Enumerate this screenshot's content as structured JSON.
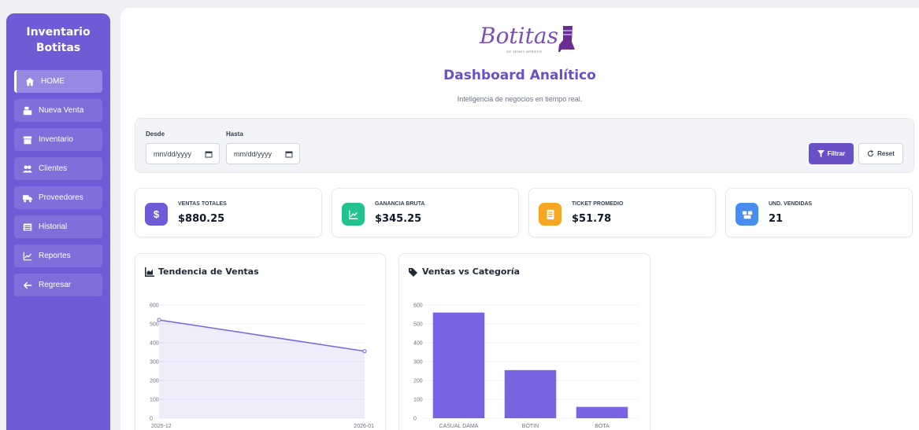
{
  "sidebar": {
    "brand_line1": "Inventario",
    "brand_line2": "Botitas",
    "items": [
      {
        "label": "HOME",
        "icon": "home-icon",
        "active": true
      },
      {
        "label": "Nueva Venta",
        "icon": "cash-register-icon"
      },
      {
        "label": "Inventario",
        "icon": "box-icon"
      },
      {
        "label": "Clientes",
        "icon": "users-icon"
      },
      {
        "label": "Proveedores",
        "icon": "truck-icon"
      },
      {
        "label": "Historial",
        "icon": "list-icon"
      },
      {
        "label": "Reportes",
        "icon": "chart-line-icon"
      },
      {
        "label": "Regresar",
        "icon": "arrow-left-icon"
      }
    ]
  },
  "header": {
    "logo_text": "Botitas",
    "logo_tagline": "DE JENNY ARROYO",
    "title": "Dashboard Analítico",
    "subtitle": "Inteligencia de negocios en tiempo real."
  },
  "filter": {
    "from_label": "Desde",
    "to_label": "Hasta",
    "from_placeholder": "mm/dd/yyyy",
    "to_placeholder": "mm/dd/yyyy",
    "filter_button": "Filtrar",
    "reset_button": "Reset"
  },
  "kpis": [
    {
      "label": "VENTAS TOTALES",
      "value": "$880.25",
      "color": "#6f5bd6",
      "icon": "dollar-icon"
    },
    {
      "label": "GANANCIA BRUTA",
      "value": "$345.25",
      "color": "#22c38e",
      "icon": "chart-area-icon"
    },
    {
      "label": "TICKET PROMEDIO",
      "value": "$51.78",
      "color": "#f5a623",
      "icon": "receipt-icon"
    },
    {
      "label": "UND. VENDIDAS",
      "value": "21",
      "color": "#4a8df0",
      "icon": "boxes-icon"
    }
  ],
  "charts": {
    "trend_title": "Tendencia de Ventas",
    "category_title": "Ventas vs Categoría"
  },
  "colors": {
    "accent": "#6a4fc7",
    "sidebar": "#6f5bd6",
    "series": "#7a63e0"
  },
  "chart_data": [
    {
      "type": "area",
      "title": "Tendencia de Ventas",
      "x": [
        "2025-12",
        "2026-01"
      ],
      "values": [
        521,
        355
      ],
      "ylim": [
        0,
        600
      ],
      "yticks": [
        0,
        100,
        200,
        300,
        400,
        500,
        600
      ],
      "grid": true,
      "legend": "bottom"
    },
    {
      "type": "bar",
      "title": "Ventas vs Categoría",
      "categories": [
        "CASUAL DAMA",
        "BOTIN",
        "BOTA"
      ],
      "values": [
        560,
        255,
        60
      ],
      "ylim": [
        0,
        600
      ],
      "yticks": [
        0,
        100,
        200,
        300,
        400,
        500,
        600
      ],
      "grid": true,
      "legend": "bottom"
    }
  ]
}
